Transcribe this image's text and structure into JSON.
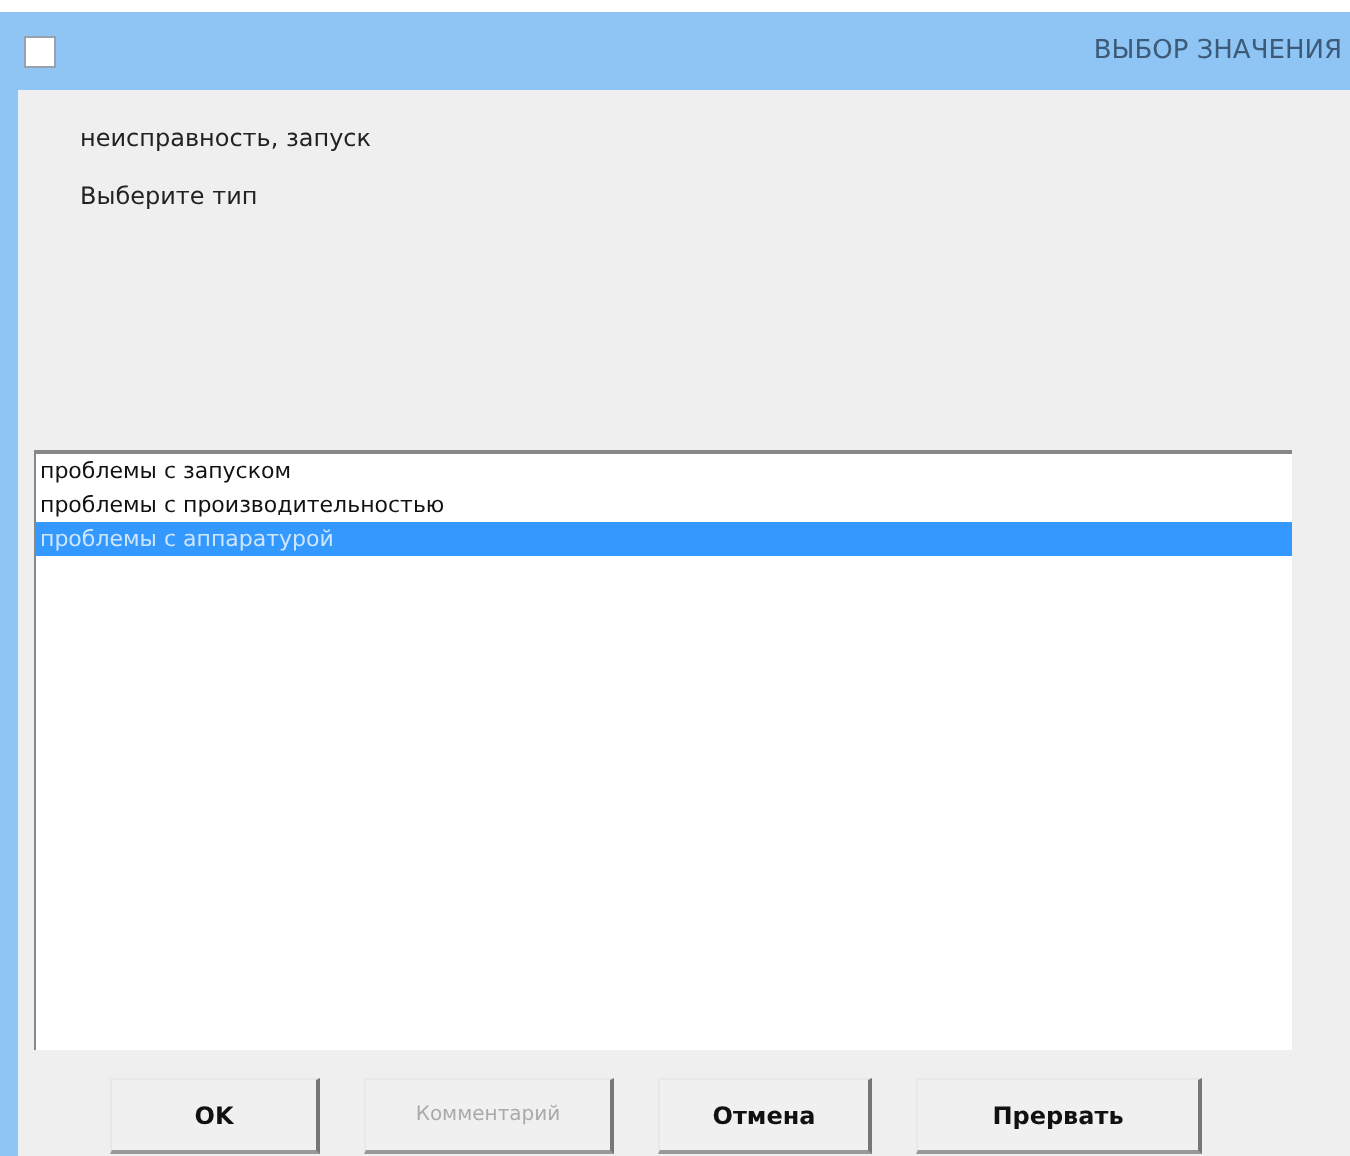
{
  "window": {
    "title": "ВЫБОР ЗНАЧЕНИЯ"
  },
  "context": "неисправность, запуск",
  "prompt": "Выберите тип",
  "list": {
    "items": [
      {
        "label": "проблемы с запуском",
        "selected": false
      },
      {
        "label": "проблемы с производительностью",
        "selected": false
      },
      {
        "label": "проблемы с аппаратурой",
        "selected": true
      }
    ]
  },
  "buttons": [
    {
      "label": "OK",
      "disabled": false
    },
    {
      "label": "Комментарий",
      "disabled": true
    },
    {
      "label": "Отмена",
      "disabled": false
    },
    {
      "label": "Прервать",
      "disabled": false
    }
  ]
}
